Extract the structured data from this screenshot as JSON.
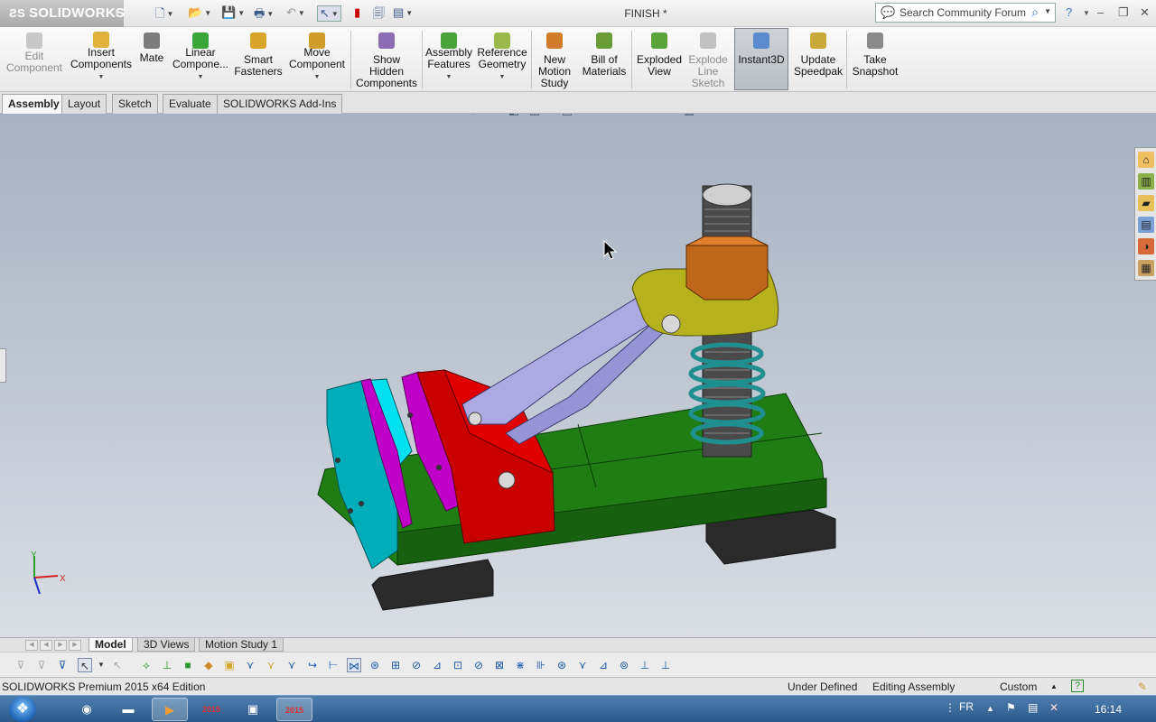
{
  "app": {
    "brand": "SOLIDWORKS",
    "document_title": "FINISH *"
  },
  "search": {
    "placeholder": "Search Community Forum"
  },
  "ribbon": {
    "edit_component": "Edit\nComponent",
    "insert_components": "Insert\nComponents",
    "mate": "Mate",
    "linear_component": "Linear\nCompone...",
    "smart_fasteners": "Smart\nFasteners",
    "move_component": "Move\nComponent",
    "show_hidden": "Show\nHidden\nComponents",
    "assembly_features": "Assembly\nFeatures",
    "reference_geometry": "Reference\nGeometry",
    "new_motion_study": "New\nMotion\nStudy",
    "bill_of_materials": "Bill of\nMaterials",
    "exploded_view": "Exploded\nView",
    "explode_line_sketch": "Explode\nLine\nSketch",
    "instant3d": "Instant3D",
    "update_speedpak": "Update\nSpeedpak",
    "take_snapshot": "Take\nSnapshot"
  },
  "command_tabs": [
    "Assembly",
    "Layout",
    "Sketch",
    "Evaluate",
    "SOLIDWORKS Add-Ins"
  ],
  "triad": {
    "x": "X",
    "y": "Y"
  },
  "bottom_tabs": [
    "Model",
    "3D Views",
    "Motion Study 1"
  ],
  "status": {
    "edition": "SOLIDWORKS Premium 2015 x64 Edition",
    "definition": "Under Defined",
    "mode": "Editing Assembly",
    "units": "Custom"
  },
  "taskbar": {
    "language": "FR",
    "time": "16:14",
    "sw_badge": "2015"
  },
  "colors": {
    "accent": "#3b7bd0",
    "base_green": "#1e7d12",
    "jaw_red": "#c40000",
    "plate_cyan": "#00a8b5",
    "plate_magenta": "#c000c8",
    "link_lavender": "#a9a6e0",
    "clevis_yellow": "#b5b21e",
    "nut_orange": "#c0661a",
    "spring_teal": "#1f8f8f"
  }
}
